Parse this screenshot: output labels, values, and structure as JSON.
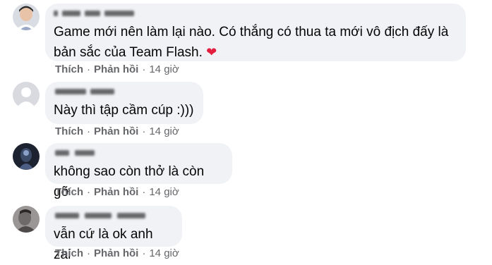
{
  "comments": [
    {
      "text": "Game mới nên làm lại nào. Có thắng có thua ta mới vô địch đấy là bản sắc của Team Flash.",
      "heart": "❤",
      "like": "Thích",
      "reply": "Phản hồi",
      "sep": "·",
      "time": "14 giờ"
    },
    {
      "text": "Này thì tập cầm cúp :)))",
      "like": "Thích",
      "reply": "Phản hồi",
      "sep": "·",
      "time": "14 giờ"
    },
    {
      "text": "không sao còn thở là còn gỡ",
      "like": "Thích",
      "reply": "Phản hồi",
      "sep": "·",
      "time": "14 giờ"
    },
    {
      "text": "vẫn cứ là ok anh zai",
      "like": "Thích",
      "reply": "Phản hồi",
      "sep": "·",
      "time": "14 giờ"
    }
  ],
  "colors": {
    "bubble": "#f0f2f5",
    "meta": "#65676b",
    "heart": "#e41e3f"
  }
}
